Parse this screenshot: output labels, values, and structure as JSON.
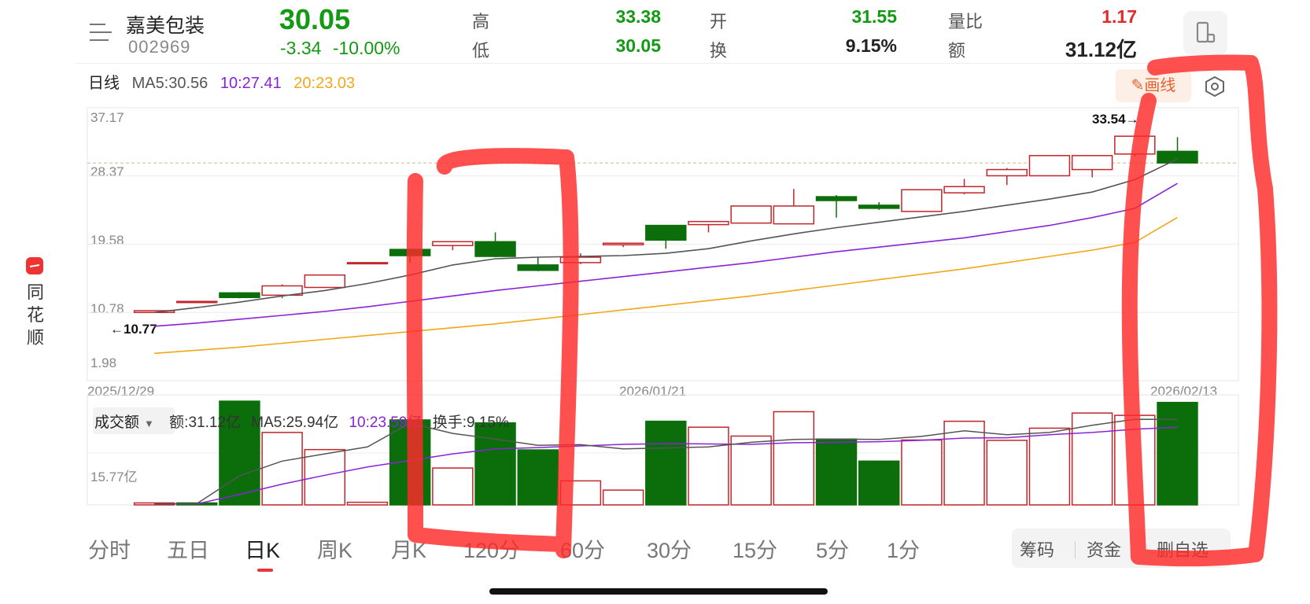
{
  "brand": {
    "name": "同花顺"
  },
  "header": {
    "stock_name": "嘉美包装",
    "stock_code": "002969",
    "price": "30.05",
    "change": "-3.34",
    "change_pct": "-10.00%",
    "high_label": "高",
    "high": "33.38",
    "low_label": "低",
    "low": "30.05",
    "open_label": "开",
    "open": "31.55",
    "turnover_label": "换",
    "turnover": "9.15%",
    "vol_ratio_label": "量比",
    "vol_ratio": "1.17",
    "amount_label": "额",
    "amount": "31.12亿"
  },
  "ma_legend": {
    "period": "日线",
    "ma5": "MA5:30.56",
    "ma10": "10:27.41",
    "ma20": "20:23.03"
  },
  "draw_button": "画线",
  "chart_axis": {
    "y_ticks": [
      "37.17",
      "28.37",
      "19.58",
      "10.78",
      "1.98"
    ],
    "dates": [
      "2025/12/29",
      "2026/01/21",
      "2026/02/13"
    ],
    "max_marker": "33.54→",
    "min_marker": "←10.77"
  },
  "volume_legend": {
    "selector": "成交额",
    "amount": "额:31.12亿",
    "ma5": "MA5:25.94亿",
    "ma10": "10:23.59亿",
    "turnover": "换手:9.15%",
    "y_tick": "15.77亿"
  },
  "tabs": [
    "分时",
    "五日",
    "日K",
    "周K",
    "月K",
    "120分",
    "60分",
    "30分",
    "15分",
    "5分",
    "1分"
  ],
  "active_tab": "日K",
  "actions": [
    "筹码",
    "资金",
    "删自选"
  ],
  "colors": {
    "up": "#c0262c",
    "down": "#0b6e0b",
    "ma5": "#555555",
    "ma10": "#8a22d6",
    "ma20": "#f0a818",
    "annotation": "#ff2a2a"
  },
  "chart_data": {
    "type": "candlestick",
    "title": "",
    "xlabel": "",
    "ylabel": "",
    "ylim": [
      1.98,
      37.17
    ],
    "x": [
      "2025/12/29",
      "",
      "",
      "",
      "",
      "",
      "",
      "",
      "",
      "",
      "",
      "",
      "",
      "2026/01/21",
      "",
      "",
      "",
      "",
      "",
      "",
      "",
      "",
      "",
      "",
      "",
      "",
      "2026/02/13"
    ],
    "candles": [
      {
        "o": 10.77,
        "h": 11.0,
        "l": 10.77,
        "c": 11.0
      },
      {
        "o": 12.1,
        "h": 12.2,
        "l": 12.1,
        "c": 12.2
      },
      {
        "o": 13.3,
        "h": 13.4,
        "l": 12.6,
        "c": 12.7
      },
      {
        "o": 13.0,
        "h": 14.4,
        "l": 12.6,
        "c": 14.2
      },
      {
        "o": 14.0,
        "h": 15.6,
        "l": 14.0,
        "c": 15.6
      },
      {
        "o": 17.2,
        "h": 17.2,
        "l": 17.2,
        "c": 17.2
      },
      {
        "o": 18.9,
        "h": 18.9,
        "l": 17.2,
        "c": 18.1
      },
      {
        "o": 19.4,
        "h": 19.9,
        "l": 18.8,
        "c": 19.9
      },
      {
        "o": 19.9,
        "h": 21.1,
        "l": 17.9,
        "c": 18.0
      },
      {
        "o": 16.9,
        "h": 17.9,
        "l": 16.1,
        "c": 16.2
      },
      {
        "o": 17.2,
        "h": 18.4,
        "l": 17.0,
        "c": 17.9
      },
      {
        "o": 19.5,
        "h": 19.7,
        "l": 19.2,
        "c": 19.7
      },
      {
        "o": 22.0,
        "h": 22.0,
        "l": 19.0,
        "c": 20.1
      },
      {
        "o": 22.1,
        "h": 22.5,
        "l": 21.1,
        "c": 22.5
      },
      {
        "o": 22.3,
        "h": 24.5,
        "l": 22.3,
        "c": 24.5
      },
      {
        "o": 22.2,
        "h": 26.7,
        "l": 22.2,
        "c": 24.5
      },
      {
        "o": 25.7,
        "h": 25.9,
        "l": 23.0,
        "c": 25.2
      },
      {
        "o": 24.6,
        "h": 25.0,
        "l": 24.0,
        "c": 24.2
      },
      {
        "o": 23.8,
        "h": 26.6,
        "l": 23.8,
        "c": 26.6
      },
      {
        "o": 26.2,
        "h": 28.0,
        "l": 26.0,
        "c": 27.0
      },
      {
        "o": 28.4,
        "h": 29.4,
        "l": 27.2,
        "c": 29.2
      },
      {
        "o": 28.4,
        "h": 31.0,
        "l": 28.4,
        "c": 31.0
      },
      {
        "o": 29.2,
        "h": 31.0,
        "l": 28.2,
        "c": 31.0
      },
      {
        "o": 31.2,
        "h": 33.5,
        "l": 30.9,
        "c": 33.5
      },
      {
        "o": 31.55,
        "h": 33.38,
        "l": 30.05,
        "c": 30.05
      }
    ],
    "ma5": [
      10.77,
      11.4,
      12.1,
      12.9,
      13.6,
      14.5,
      15.6,
      16.9,
      17.7,
      17.9,
      18.0,
      18.1,
      18.4,
      19.0,
      20.0,
      20.9,
      21.7,
      22.4,
      23.1,
      23.8,
      24.6,
      25.4,
      26.3,
      27.9,
      30.56
    ],
    "ma10": [
      9.0,
      9.4,
      9.9,
      10.4,
      10.9,
      11.5,
      12.2,
      12.9,
      13.6,
      14.2,
      14.8,
      15.4,
      16.0,
      16.6,
      17.2,
      17.9,
      18.6,
      19.2,
      19.8,
      20.4,
      21.2,
      22.0,
      23.0,
      24.2,
      27.41
    ],
    "ma20": [
      5.5,
      5.9,
      6.3,
      6.8,
      7.3,
      7.8,
      8.3,
      8.8,
      9.3,
      9.9,
      10.5,
      11.1,
      11.7,
      12.3,
      12.9,
      13.6,
      14.3,
      15.0,
      15.7,
      16.4,
      17.2,
      18.0,
      18.8,
      19.8,
      23.03
    ],
    "volume_unit": "亿",
    "volume": [
      {
        "v": 0.6,
        "dir": "up"
      },
      {
        "v": 0.6,
        "dir": "down"
      },
      {
        "v": 31.5,
        "dir": "down"
      },
      {
        "v": 22.0,
        "dir": "up"
      },
      {
        "v": 16.8,
        "dir": "up"
      },
      {
        "v": 0.8,
        "dir": "up"
      },
      {
        "v": 25.8,
        "dir": "down"
      },
      {
        "v": 11.2,
        "dir": "up"
      },
      {
        "v": 24.9,
        "dir": "down"
      },
      {
        "v": 16.7,
        "dir": "down"
      },
      {
        "v": 7.3,
        "dir": "up"
      },
      {
        "v": 4.5,
        "dir": "up"
      },
      {
        "v": 25.4,
        "dir": "down"
      },
      {
        "v": 23.6,
        "dir": "up"
      },
      {
        "v": 20.9,
        "dir": "up"
      },
      {
        "v": 28.3,
        "dir": "up"
      },
      {
        "v": 20.0,
        "dir": "down"
      },
      {
        "v": 13.3,
        "dir": "down"
      },
      {
        "v": 19.7,
        "dir": "up"
      },
      {
        "v": 25.4,
        "dir": "up"
      },
      {
        "v": 19.6,
        "dir": "up"
      },
      {
        "v": 23.3,
        "dir": "up"
      },
      {
        "v": 27.9,
        "dir": "up"
      },
      {
        "v": 27.2,
        "dir": "up"
      },
      {
        "v": 31.12,
        "dir": "down"
      }
    ],
    "volume_ma5": [
      0.3,
      0.4,
      8.8,
      13.3,
      15.5,
      17.6,
      24.8,
      21.7,
      20.0,
      18.1,
      18.3,
      17.0,
      17.3,
      17.6,
      19.0,
      19.9,
      20.0,
      19.9,
      20.8,
      22.5,
      21.3,
      22.0,
      24.2,
      26.0,
      25.94
    ],
    "volume_ma10": [
      0.3,
      0.3,
      3.2,
      6.3,
      9.0,
      11.5,
      13.5,
      15.5,
      17.0,
      17.4,
      17.9,
      18.4,
      18.6,
      18.5,
      18.4,
      18.9,
      19.0,
      19.2,
      19.6,
      20.3,
      20.4,
      21.3,
      22.0,
      23.0,
      23.59
    ],
    "ylim_volume": [
      0,
      32
    ]
  }
}
